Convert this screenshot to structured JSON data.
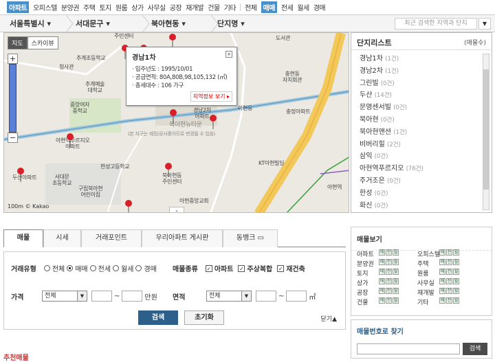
{
  "topnav": {
    "types": [
      "아파트",
      "오피스텔",
      "분양권",
      "주택",
      "토지",
      "원룸",
      "상가",
      "사무실",
      "공장",
      "재개발",
      "건물",
      "기타"
    ],
    "deals": [
      "전체",
      "매매",
      "전세",
      "월세",
      "경매"
    ]
  },
  "location": {
    "crumbs": [
      "서울특별시",
      "서대문구",
      "북아현동",
      "단지명"
    ],
    "recent_placeholder": "최근 검색한 지역과 단지",
    "recent_dd": "▼"
  },
  "map": {
    "type_buttons": [
      "지도",
      "스카이뷰"
    ],
    "zoom_in": "+",
    "zoom_out": "−",
    "popup": {
      "title": "경남1차",
      "close": "×",
      "lines": [
        "· 입주년도 : 1995/10/01",
        "· 공급면적: 80A,80B,98,105,132 (㎡)",
        "· 총세대수 : 106 가구"
      ],
      "button": "지역정보 보기 ▸"
    },
    "labels": {
      "l1": "주민센터",
      "l2": "청사관",
      "l3": "추계초등학교",
      "l4": "추계예술\n대학교",
      "l5": "중앙여자\n중학교",
      "l6": "아현역푸르지오\n아파트",
      "l7": "두산아파트",
      "l8": "서대문\n초등학교",
      "l9": "한성고등학교",
      "l10": "구립북아현\n어린이집",
      "l11": "북아현동\n주민센터",
      "l12": "북아현뉴타운",
      "l13": "(본 지구는 예정/공사중이므로 변경될 수 있음)",
      "l14": "충현동\n자치회관",
      "l15": "충정아파트",
      "l16": "KT아현빌딩",
      "l17": "아현역",
      "l18": "도서관",
      "l19": "경남2차\n아파트",
      "l20": "아현동",
      "l21": "아현중앙교회"
    },
    "scale": "100m  © Kakao",
    "fold": "⌄"
  },
  "complex_list": {
    "title": "단지리스트",
    "count_label": "(매물수)",
    "items": [
      {
        "name": "경남1차",
        "count": "(1건)"
      },
      {
        "name": "경남2차",
        "count": "(1건)"
      },
      {
        "name": "그린빌",
        "count": "(0건)"
      },
      {
        "name": "두산",
        "count": "(14건)"
      },
      {
        "name": "문영센서빌",
        "count": "(0건)"
      },
      {
        "name": "북아현",
        "count": "(0건)"
      },
      {
        "name": "북아현맨션",
        "count": "(1건)"
      },
      {
        "name": "비버리힐",
        "count": "(2건)"
      },
      {
        "name": "삼익",
        "count": "(0건)"
      },
      {
        "name": "아현역푸르지오",
        "count": "(76건)"
      },
      {
        "name": "주거조은",
        "count": "(0건)"
      },
      {
        "name": "한성",
        "count": "(0건)"
      },
      {
        "name": "화신",
        "count": "(0건)"
      }
    ]
  },
  "tabs": [
    "매물",
    "시세",
    "거래포인트",
    "우리아파트 게시판",
    "동뱅크"
  ],
  "form": {
    "deal_type_label": "거래유형",
    "deal_options": [
      "전체",
      "매매",
      "전세",
      "월세",
      "경매"
    ],
    "deal_selected": 1,
    "item_type_label": "매물종류",
    "item_options": [
      "아파트",
      "주상복합",
      "재건축"
    ],
    "price_label": "가격",
    "price_select": "전체",
    "price_unit": "만원",
    "area_label": "면적",
    "area_select": "전체",
    "area_unit": "㎡",
    "tilde": "~",
    "search_btn": "검색",
    "reset_btn": "초기화",
    "collapse": "닫기▲"
  },
  "listing_box": {
    "title": "매물보기",
    "items": [
      "아파트",
      "오피스텔",
      "분양권",
      "주택",
      "토지",
      "원룸",
      "상가",
      "사무실",
      "공장",
      "재개발",
      "건물",
      "기타"
    ],
    "mini": [
      "매",
      "전",
      "월"
    ]
  },
  "number_search": {
    "title": "매물번호로 찾기",
    "button": "검색"
  },
  "recommend": "추천매물"
}
